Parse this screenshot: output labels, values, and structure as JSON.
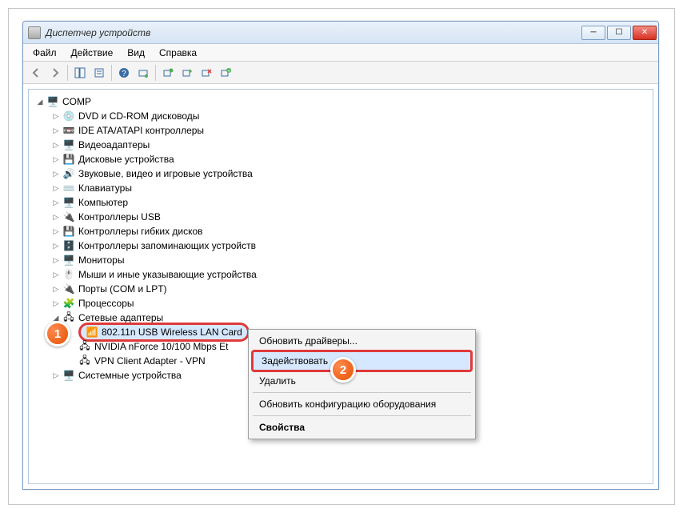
{
  "window": {
    "title": "Диспетчер устройств"
  },
  "menubar": {
    "file": "Файл",
    "action": "Действие",
    "view": "Вид",
    "help": "Справка"
  },
  "tree": {
    "root": "COMP",
    "dvd": "DVD и CD-ROM дисководы",
    "ide": "IDE ATA/ATAPI контроллеры",
    "video": "Видеоадаптеры",
    "disk": "Дисковые устройства",
    "sound": "Звуковые, видео и игровые устройства",
    "keyboard": "Клавиатуры",
    "computer": "Компьютер",
    "usb": "Контроллеры USB",
    "floppy": "Контроллеры гибких дисков",
    "storage": "Контроллеры запоминающих устройств",
    "monitors": "Мониторы",
    "mice": "Мыши и иные указывающие устройства",
    "ports": "Порты (COM и LPT)",
    "cpu": "Процессоры",
    "netadapters": "Сетевые адаптеры",
    "wlan": "802.11n USB Wireless LAN Card",
    "nforce": "NVIDIA nForce 10/100 Mbps Et",
    "vpn": "VPN Client Adapter - VPN",
    "system": "Системные устройства"
  },
  "context": {
    "update": "Обновить драйверы...",
    "enable": "Задействовать",
    "delete": "Удалить",
    "refresh": "Обновить конфигурацию оборудования",
    "props": "Свойства"
  },
  "badges": {
    "one": "1",
    "two": "2"
  }
}
